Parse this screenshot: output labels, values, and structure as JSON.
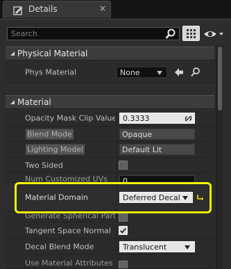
{
  "tab": {
    "title": "Details",
    "close_glyph": "×",
    "icon": "details-icon"
  },
  "toolbar": {
    "search_placeholder": "Search",
    "search_value": "",
    "grid_icon": "grid-view-icon",
    "eye_icon": "eye-icon"
  },
  "sections": {
    "physical": {
      "title": "Physical Material",
      "phys_label": "Phys Material",
      "phys_value": "None"
    },
    "material": {
      "title": "Material",
      "opacity_label": "Opacity Mask Clip Value",
      "opacity_value": "0.3333",
      "blend_label": "Blend Mode",
      "blend_value": "Opaque",
      "lighting_label": "Lighting Model",
      "lighting_value": "Default Lit",
      "two_sided_label": "Two Sided",
      "num_custom_label": "Num Customized UVs",
      "num_custom_value": "0",
      "domain_label": "Material Domain",
      "domain_value": "Deferred Decal",
      "gen_spherical_label": "Generate Spherical Parti",
      "tangent_label": "Tangent Space Normal",
      "tangent_checked": true,
      "decal_label": "Decal Blend Mode",
      "decal_value": "Translucent",
      "use_attrs_label": "Use Material Attributes"
    }
  },
  "colors": {
    "highlight": "#f5f500",
    "panel": "#2d2d2d",
    "accent": "#e6e6e6"
  }
}
